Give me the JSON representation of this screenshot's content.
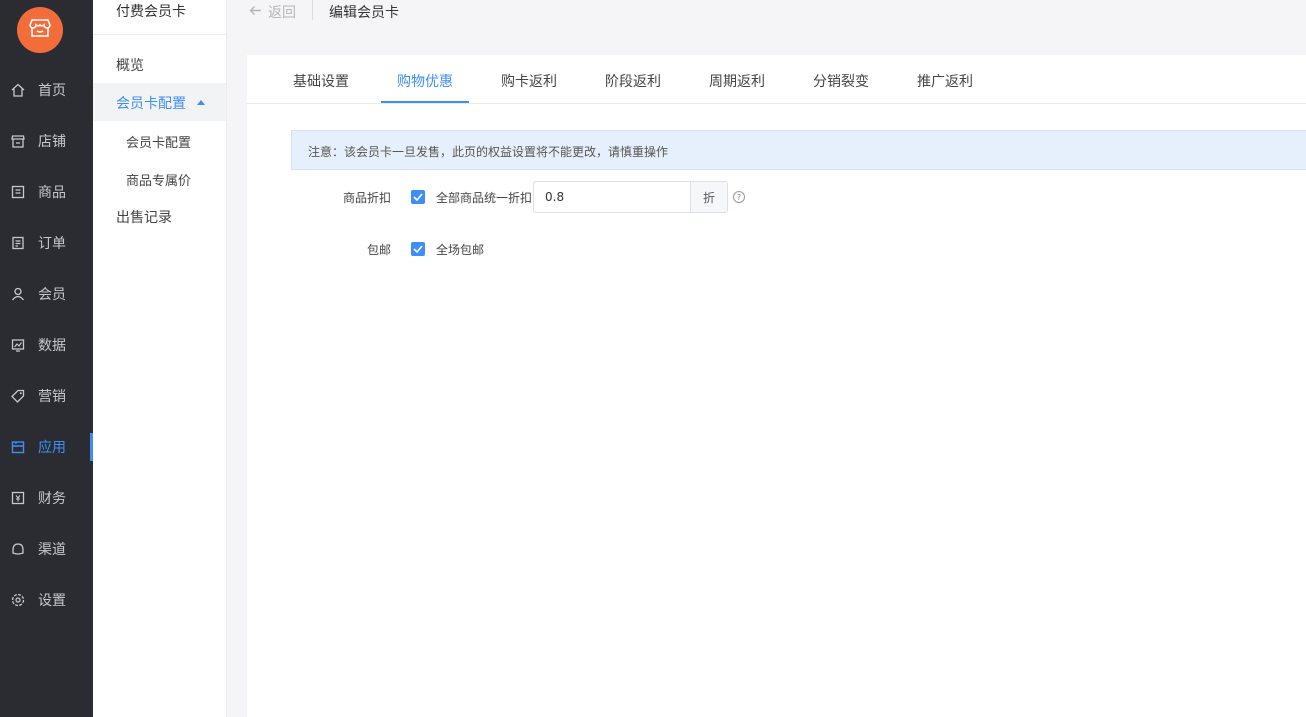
{
  "sidebar": {
    "logo_icon": "store-icon",
    "active_color": "#3e8ef7",
    "items": [
      {
        "label": "首页",
        "icon": "home-icon"
      },
      {
        "label": "店铺",
        "icon": "shop-icon"
      },
      {
        "label": "商品",
        "icon": "goods-icon"
      },
      {
        "label": "订单",
        "icon": "order-icon"
      },
      {
        "label": "会员",
        "icon": "user-icon"
      },
      {
        "label": "数据",
        "icon": "chart-icon"
      },
      {
        "label": "营销",
        "icon": "tag-icon"
      },
      {
        "label": "应用",
        "icon": "app-icon",
        "active": true
      },
      {
        "label": "财务",
        "icon": "finance-icon"
      },
      {
        "label": "渠道",
        "icon": "channel-icon"
      },
      {
        "label": "设置",
        "icon": "gear-icon"
      }
    ]
  },
  "subnav": {
    "title": "付费会员卡",
    "overview": "概览",
    "group_label": "会员卡配置",
    "children": [
      "会员卡配置",
      "商品专属价"
    ],
    "sales_record": "出售记录"
  },
  "topbar": {
    "back_label": "返回",
    "title": "编辑会员卡"
  },
  "tabs": [
    "基础设置",
    "购物优惠",
    "购卡返利",
    "阶段返利",
    "周期返利",
    "分销裂变",
    "推广返利"
  ],
  "active_tab": "购物优惠",
  "notice": "注意：该会员卡一旦发售，此页的权益设置将不能更改，请慎重操作",
  "form": {
    "discount": {
      "label": "商品折扣",
      "checked": true,
      "checkbox_text": "全部商品统一折扣",
      "value": "0.8",
      "unit": "折",
      "help_icon": "question-circle-icon"
    },
    "shipping": {
      "label": "包邮",
      "checked": true,
      "checkbox_text": "全场包邮"
    }
  }
}
